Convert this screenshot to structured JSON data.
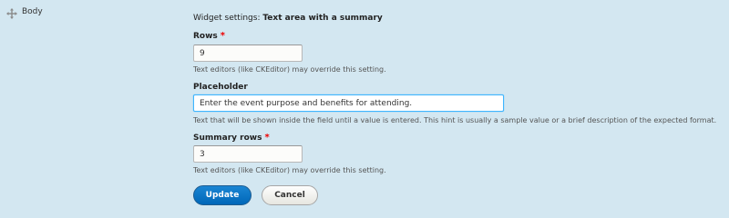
{
  "field_row": {
    "drag_icon": "move-arrows-icon",
    "label": "Body"
  },
  "widget_settings": {
    "prefix": "Widget settings: ",
    "type": "Text area with a summary"
  },
  "rows": {
    "label": "Rows",
    "required_mark": "*",
    "value": "9",
    "description": "Text editors (like CKEditor) may override this setting."
  },
  "placeholder": {
    "label": "Placeholder",
    "value": "Enter the event purpose and benefits for attending.",
    "description": "Text that will be shown inside the field until a value is entered. This hint is usually a sample value or a brief description of the expected format."
  },
  "summary_rows": {
    "label": "Summary rows",
    "required_mark": "*",
    "value": "3",
    "description": "Text editors (like CKEditor) may override this setting."
  },
  "actions": {
    "update_label": "Update",
    "cancel_label": "Cancel"
  },
  "colors": {
    "background": "#d3e7f1",
    "primary_button": "#0067b8",
    "required": "#e00000",
    "focus_border": "#40b6ff"
  }
}
